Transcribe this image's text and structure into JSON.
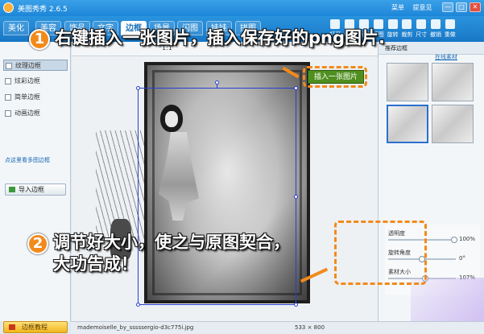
{
  "app": {
    "title": "美图秀秀 2.6.5",
    "links": [
      "菜单",
      "提意见"
    ]
  },
  "window_buttons": [
    "—",
    "□",
    "✕"
  ],
  "tabs": [
    {
      "label": "美化",
      "active": false
    },
    {
      "label": "美容",
      "active": false
    },
    {
      "label": "饰品",
      "active": false
    },
    {
      "label": "文字",
      "active": false
    },
    {
      "label": "边框",
      "active": true
    },
    {
      "label": "场景",
      "active": false
    },
    {
      "label": "闪图",
      "active": false
    },
    {
      "label": "娃娃",
      "active": false
    },
    {
      "label": "拼图",
      "active": false
    }
  ],
  "tools": [
    "打开",
    "保存",
    "新建",
    "抠图",
    "旋转",
    "裁剪",
    "尺寸",
    "撤销",
    "重做"
  ],
  "subtool": {
    "zoom": "1:1"
  },
  "left_panel": {
    "items": [
      {
        "label": "纹理边框",
        "selected": true
      },
      {
        "label": "炫彩边框",
        "selected": false
      },
      {
        "label": "简单边框",
        "selected": false
      },
      {
        "label": "动画边框",
        "selected": false
      }
    ],
    "more_link": "点这里看多图边框",
    "import_button": "导入边框",
    "tutorial_button": "边框教程"
  },
  "right_panel": {
    "header": "推荐边框",
    "more_link": "在线素材"
  },
  "adjust": [
    {
      "label": "透明度",
      "value": "100%",
      "level": 1.0
    },
    {
      "label": "旋转角度",
      "value": "0°",
      "level": 0.5
    },
    {
      "label": "素材大小",
      "value": "107%",
      "level": 0.55
    }
  ],
  "status": {
    "filename": "mademoiselle_by_sssssergio-d3c775i.jpg",
    "size": "533 × 800"
  },
  "annotations": {
    "step1": {
      "number": "1",
      "text": "右键插入一张图片，插入保存好的png图片.",
      "label": "插入一张图片"
    },
    "step2": {
      "number": "2",
      "text": "调节好大小，使之与原图契合，大功告成！"
    }
  },
  "colors": {
    "accent_blue": "#1d86d8",
    "annotation_orange": "#f28a1b",
    "insert_green": "#4f8f1f"
  }
}
